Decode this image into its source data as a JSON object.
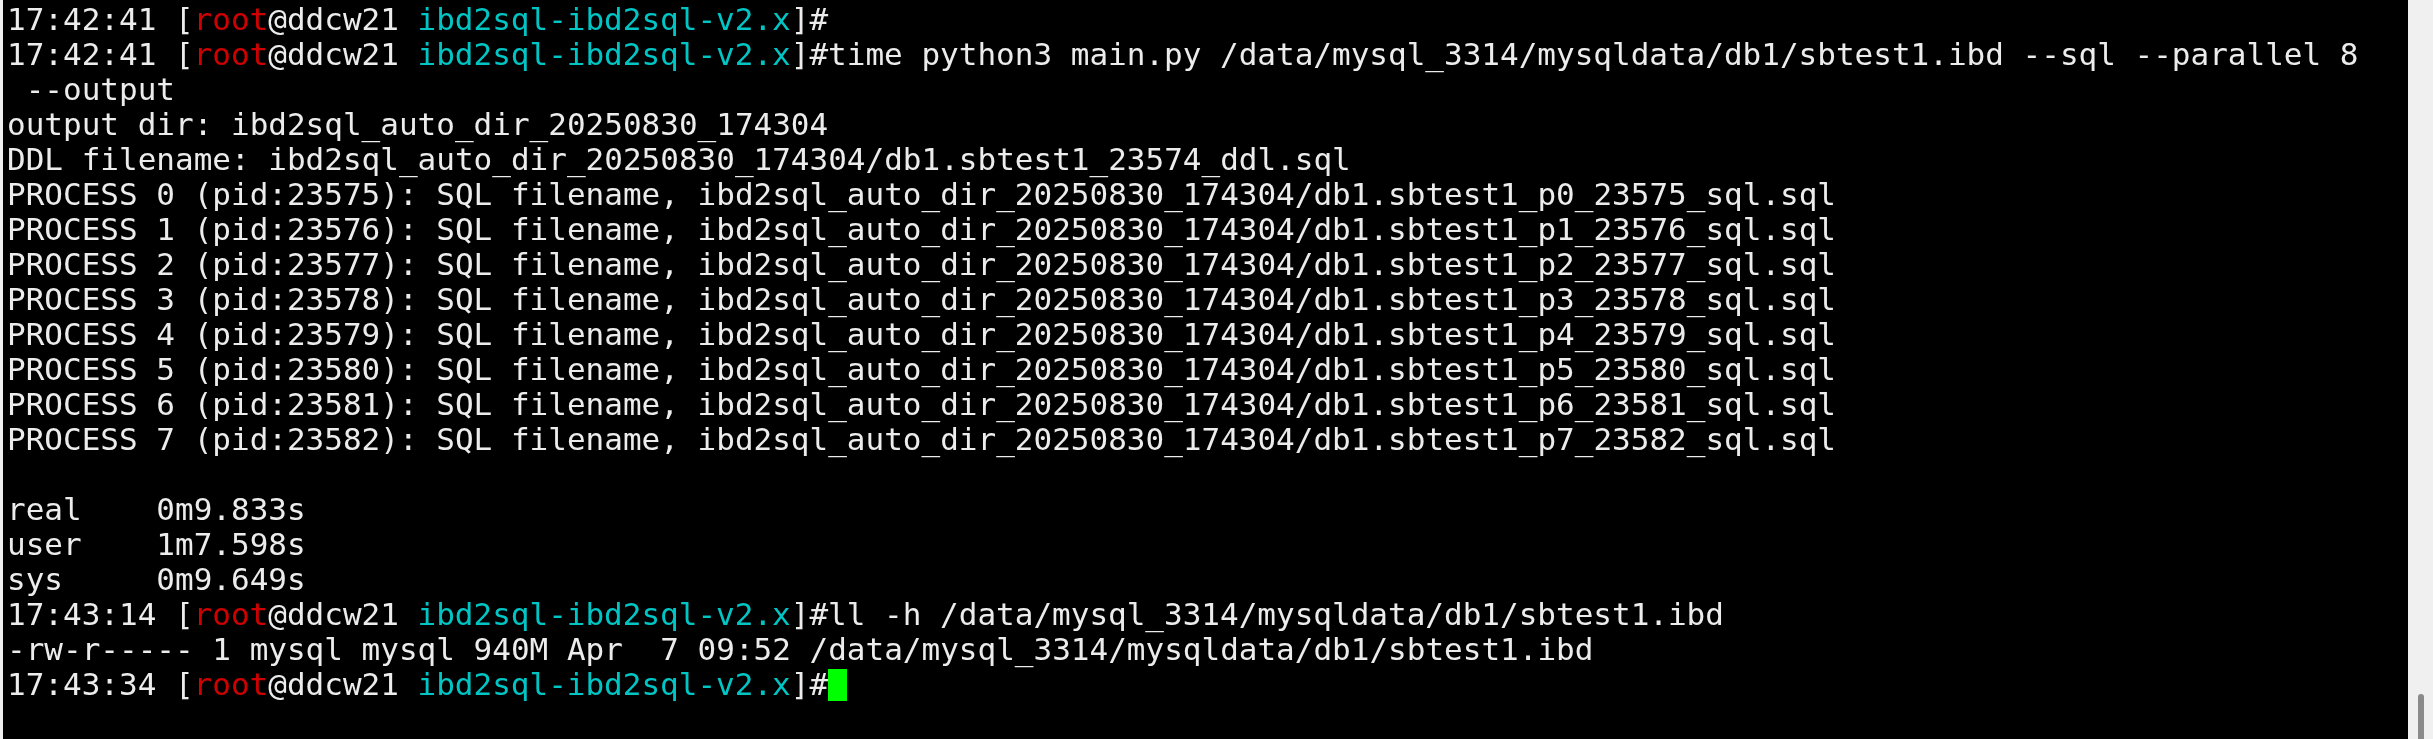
{
  "terminal": {
    "lines": [
      {
        "kind": "prompt",
        "time": "17:42:41",
        "open": "[",
        "user": "root",
        "host": "@ddcw21",
        "dir": "ibd2sql-ibd2sql-v2.x",
        "end": "]#"
      },
      {
        "kind": "prompt",
        "time": "17:42:41",
        "open": "[",
        "user": "root",
        "host": "@ddcw21",
        "dir": "ibd2sql-ibd2sql-v2.x",
        "end": "]#",
        "command": "time python3 main.py /data/mysql_3314/mysqldata/db1/sbtest1.ibd --sql --parallel 8"
      },
      {
        "kind": "output",
        "text": " --output"
      },
      {
        "kind": "output",
        "text": "output dir: ibd2sql_auto_dir_20250830_174304"
      },
      {
        "kind": "output",
        "text": "DDL filename: ibd2sql_auto_dir_20250830_174304/db1.sbtest1_23574_ddl.sql"
      },
      {
        "kind": "output",
        "text": "PROCESS 0 (pid:23575): SQL filename, ibd2sql_auto_dir_20250830_174304/db1.sbtest1_p0_23575_sql.sql"
      },
      {
        "kind": "output",
        "text": "PROCESS 1 (pid:23576): SQL filename, ibd2sql_auto_dir_20250830_174304/db1.sbtest1_p1_23576_sql.sql"
      },
      {
        "kind": "output",
        "text": "PROCESS 2 (pid:23577): SQL filename, ibd2sql_auto_dir_20250830_174304/db1.sbtest1_p2_23577_sql.sql"
      },
      {
        "kind": "output",
        "text": "PROCESS 3 (pid:23578): SQL filename, ibd2sql_auto_dir_20250830_174304/db1.sbtest1_p3_23578_sql.sql"
      },
      {
        "kind": "output",
        "text": "PROCESS 4 (pid:23579): SQL filename, ibd2sql_auto_dir_20250830_174304/db1.sbtest1_p4_23579_sql.sql"
      },
      {
        "kind": "output",
        "text": "PROCESS 5 (pid:23580): SQL filename, ibd2sql_auto_dir_20250830_174304/db1.sbtest1_p5_23580_sql.sql"
      },
      {
        "kind": "output",
        "text": "PROCESS 6 (pid:23581): SQL filename, ibd2sql_auto_dir_20250830_174304/db1.sbtest1_p6_23581_sql.sql"
      },
      {
        "kind": "output",
        "text": "PROCESS 7 (pid:23582): SQL filename, ibd2sql_auto_dir_20250830_174304/db1.sbtest1_p7_23582_sql.sql"
      },
      {
        "kind": "blank"
      },
      {
        "kind": "output",
        "text": "real\t0m9.833s"
      },
      {
        "kind": "output",
        "text": "user\t1m7.598s"
      },
      {
        "kind": "output",
        "text": "sys\t0m9.649s"
      },
      {
        "kind": "prompt",
        "time": "17:43:14",
        "open": "[",
        "user": "root",
        "host": "@ddcw21",
        "dir": "ibd2sql-ibd2sql-v2.x",
        "end": "]#",
        "command": "ll -h /data/mysql_3314/mysqldata/db1/sbtest1.ibd"
      },
      {
        "kind": "output",
        "text": "-rw-r----- 1 mysql mysql 940M Apr  7 09:52 /data/mysql_3314/mysqldata/db1/sbtest1.ibd"
      },
      {
        "kind": "prompt",
        "time": "17:43:34",
        "open": "[",
        "user": "root",
        "host": "@ddcw21",
        "dir": "ibd2sql-ibd2sql-v2.x",
        "end": "]#",
        "cursor": true
      }
    ]
  }
}
